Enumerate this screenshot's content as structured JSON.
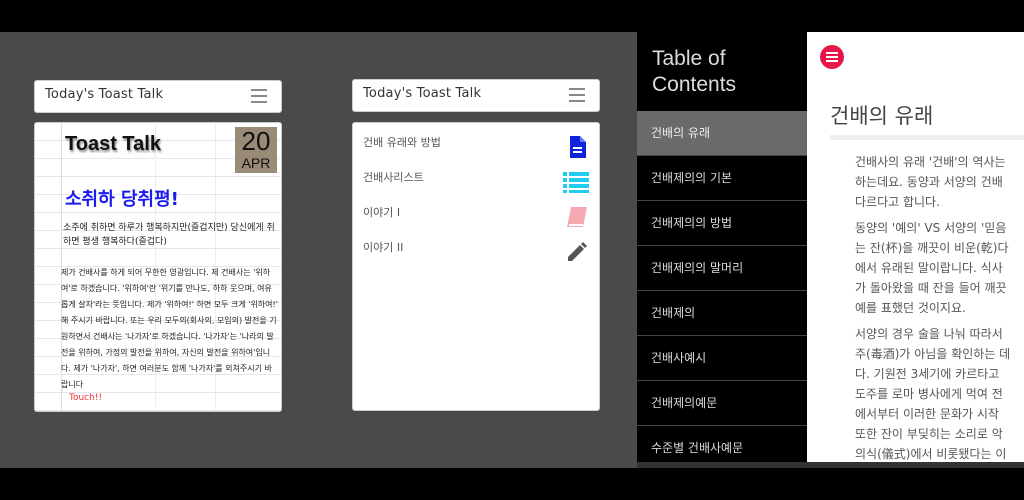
{
  "app_title": "Today's Toast Talk",
  "panel1": {
    "logo": "Toast Talk",
    "date_day": "20",
    "date_month": "APR",
    "headline": "소취하 당취평!",
    "intro": "소주에 취하면 하루가 행복하지만(즐겁지만) 당신에게 취하면 평생 행복하다(즐겁다)",
    "body": "제가 건배사를 하게 되어 무한한 영광입니다. 제 건배사는 '위하여'로 하겠습니다. '위하여'란 '위기를 만나도, 하하 웃으며, 여유롭게 살자'라는 뜻입니다. 제가 '위하여!' 하면 모두 크게 '위하여!' 해 주시기 바랍니다. 또는 우리 모두의(회사의, 모임의) 발전을 기원하면서 건배사는 '나가자'로 하겠습니다. '나가자'는 '나라의 발전을 위하여, 가정의 발전을 위하여, 자신의 발전을 위하여'입니다. 제가 '나가자', 하면 여러분도 함께 '나가자'를 외쳐주시기 바랍니다",
    "touch": "Touch!!"
  },
  "panel2": {
    "menu": [
      {
        "label": "건배 유래와 방법",
        "icon": "document-icon",
        "color": "#1122dd"
      },
      {
        "label": "건배사리스트",
        "icon": "list-icon",
        "color": "#22ccee"
      },
      {
        "label": "이야기 I",
        "icon": "book-icon",
        "color": "#f4a8b0"
      },
      {
        "label": "이야기 II",
        "icon": "pencil-icon",
        "color": "#555555"
      }
    ]
  },
  "panel3": {
    "toc_title_line1": "Table of",
    "toc_title_line2": "Contents",
    "toc": [
      "건배의 유래",
      "건배제의의 기본",
      "건배제의의 방법",
      "건배제의의 말머리",
      "건배제의",
      "건배사예시",
      "건배제의예문",
      "수준별 건배사예문"
    ],
    "active_index": 0,
    "content_title": "건배의 유래",
    "paragraphs": [
      [
        "건배사의 유래 '건배'의 역사는",
        "하는데요. 동양과 서양의 건배",
        "다르다고 합니다."
      ],
      [
        "동양의 '예의' VS 서양의 '믿음",
        "는 잔(杯)을 깨끗이 비운(乾)다",
        "에서 유래된 말이랍니다. 식사",
        "가 돌아왔을 때 잔을 들어 깨끗",
        "예를 표했던 것이지요."
      ],
      [
        "서양의 경우 술을 나눠 따라서",
        "주(毒酒)가 아님을 확인하는 데",
        "다. 기원전 3세기에 카르타고",
        "도주를 로마 병사에게 먹여 전",
        "에서부터 이러한 문화가 시작",
        "또한 잔이 부딪히는 소리로 악",
        "의식(儀式)에서 비롯됐다는 이"
      ]
    ],
    "accent_color": "#e8174a"
  }
}
